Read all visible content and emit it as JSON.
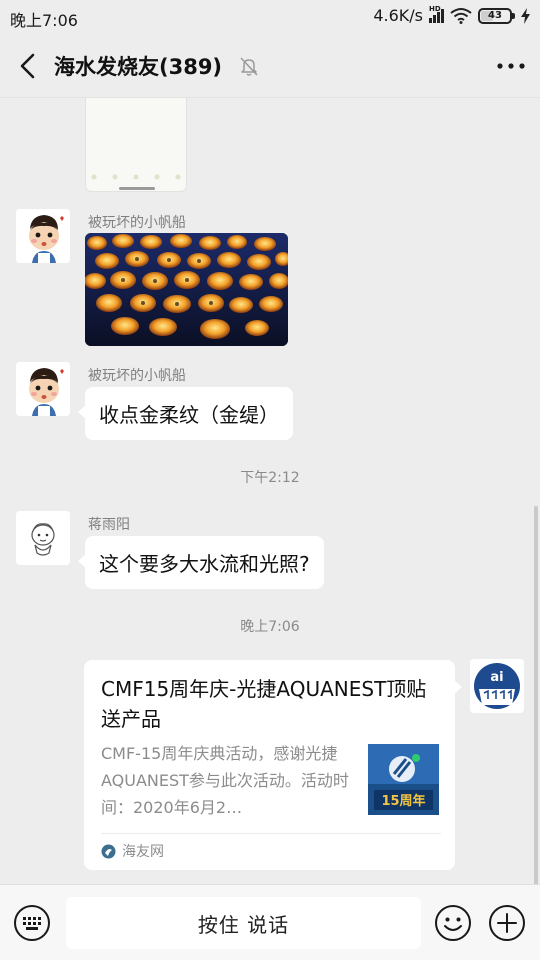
{
  "status_bar": {
    "time": "晚上7:06",
    "network_speed": "4.6K/s",
    "network_badge": "HD",
    "battery": "43"
  },
  "header": {
    "title": "海水发烧友(389)"
  },
  "messages": [
    {
      "type": "sticker",
      "sender": ""
    },
    {
      "type": "image",
      "sender": "被玩坏的小帆船"
    },
    {
      "type": "text",
      "sender": "被玩坏的小帆船",
      "text": "收点金柔纹（金缇）"
    },
    {
      "type": "time",
      "text": "下午2:12"
    },
    {
      "type": "text",
      "sender": "蒋雨阳",
      "text": "这个要多大水流和光照?"
    },
    {
      "type": "time",
      "text": "晚上7:06"
    }
  ],
  "link_card": {
    "title": "CMF15周年庆-光捷AQUANEST顶贴送产品",
    "description": "CMF-15周年庆典活动，感谢光捷AQUANEST参与此次活动。活动时间：2020年6月2…",
    "thumb_label": "15周年",
    "source": "海友网"
  },
  "input_bar": {
    "talk_label": "按住 说话"
  },
  "colors": {
    "background": "#ededed",
    "bubble": "#ffffff",
    "card_thumb_bg": "#1b4f8a"
  },
  "icons": [
    "back-icon",
    "mute-bell-icon",
    "more-icon",
    "keyboard-icon",
    "emoji-icon",
    "plus-icon"
  ]
}
